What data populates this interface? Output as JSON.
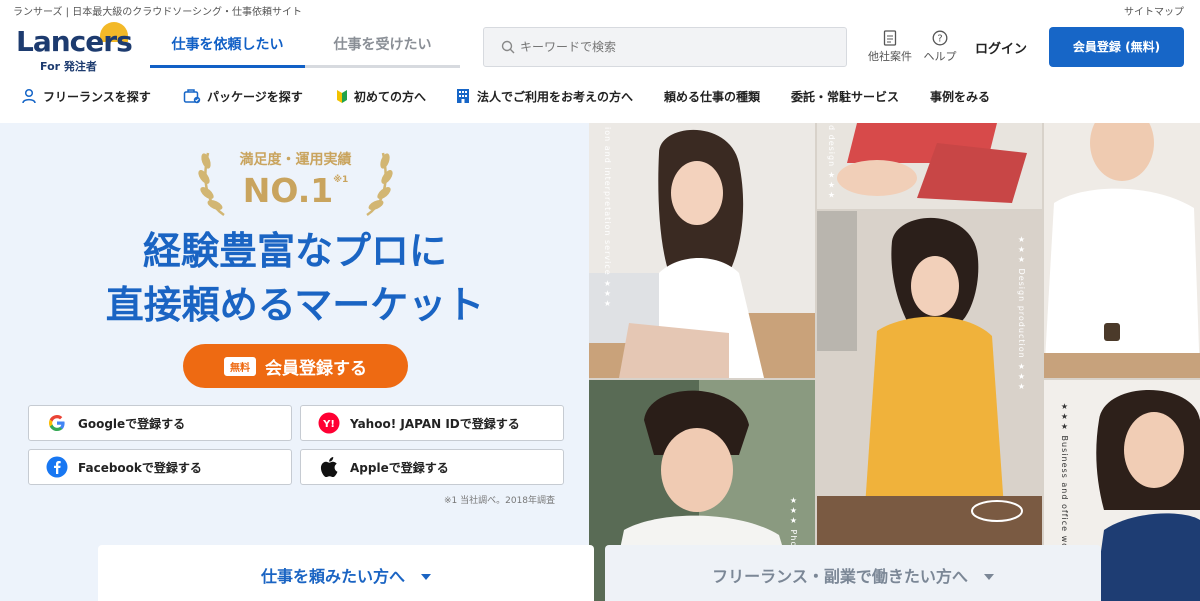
{
  "top": {
    "tagline": "ランサーズ | 日本最大級のクラウドソーシング・仕事依頼サイト",
    "sitemap": "サイトマップ"
  },
  "logo": {
    "word": "Lancers",
    "sub": "For 発注者"
  },
  "tabs": [
    {
      "label": "仕事を依頼したい",
      "active": true
    },
    {
      "label": "仕事を受けたい",
      "active": false
    }
  ],
  "search": {
    "placeholder": "キーワードで検索"
  },
  "header_links": {
    "other_jobs": "他社案件",
    "help": "ヘルプ",
    "login": "ログイン",
    "signup": "会員登録 (無料)"
  },
  "nav": [
    {
      "label": "フリーランスを探す",
      "icon": "person-icon"
    },
    {
      "label": "パッケージを探す",
      "icon": "package-icon"
    },
    {
      "label": "初めての方へ",
      "icon": "beginner-mark-icon"
    },
    {
      "label": "法人でご利用をお考えの方へ",
      "icon": "building-icon"
    },
    {
      "label": "頼める仕事の種類",
      "icon": ""
    },
    {
      "label": "委託・常駐サービス",
      "icon": ""
    },
    {
      "label": "事例をみる",
      "icon": ""
    }
  ],
  "hero": {
    "badge_top": "満足度・運用実績",
    "badge_main": "NO.1",
    "badge_note": "※1",
    "headline_line1": "経験豊富なプロに",
    "headline_line2": "直接頼めるマーケット",
    "cta_free": "無料",
    "cta_label": "会員登録する",
    "sso": [
      {
        "label": "Googleで登録する",
        "icon": "google-icon"
      },
      {
        "label": "Yahoo! JAPAN IDで登録する",
        "icon": "yahoo-japan-icon"
      },
      {
        "label": "Facebookで登録する",
        "icon": "facebook-icon"
      },
      {
        "label": "Appleで登録する",
        "icon": "apple-icon"
      }
    ],
    "footnote": "※1 当社調べ。2018年調査"
  },
  "photo_captions": {
    "translation": "ion and interpretation service ★★★",
    "design_small": "d design ★★★",
    "design": "★★★ Design production ★★★",
    "photo": "★★★ Photo",
    "business": "★★★ Business and office work ★★"
  },
  "bottom": {
    "client": "仕事を頼みたい方へ",
    "freelancer": "フリーランス・副業で働きたい方へ"
  },
  "colors": {
    "brand_blue": "#1766c7",
    "cta_orange": "#ee6a12",
    "gold": "#c9a45e",
    "hero_bg": "#edf3fb"
  }
}
